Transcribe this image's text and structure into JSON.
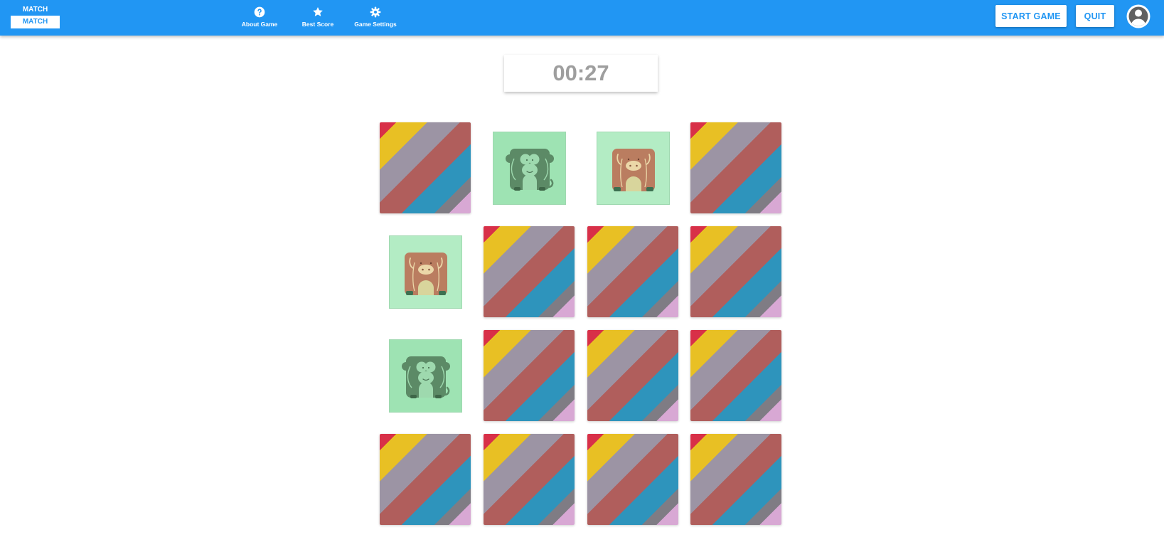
{
  "logo": {
    "top": "MATCH",
    "bottom": "MATCH"
  },
  "nav": {
    "about": {
      "label": "About Game",
      "icon": "help-circle-icon"
    },
    "best": {
      "label": "Best Score",
      "icon": "star-icon"
    },
    "settings": {
      "label": "Game Settings",
      "icon": "gear-icon"
    }
  },
  "buttons": {
    "start": "START GAME",
    "quit": "QUIT"
  },
  "user": {
    "icon": "account-circle-icon"
  },
  "timer": "00:27",
  "colors": {
    "header": "#2196f3",
    "card_front_bg": "#b3ecc4",
    "timer_text": "#9e9e9e"
  },
  "board": {
    "rows": 4,
    "cols": 4,
    "cards": [
      [
        "back",
        "monkey",
        "cow",
        "back"
      ],
      [
        "cow",
        "back",
        "back",
        "back"
      ],
      [
        "monkey",
        "back",
        "back",
        "back"
      ],
      [
        "back",
        "back",
        "back",
        "back"
      ]
    ]
  }
}
